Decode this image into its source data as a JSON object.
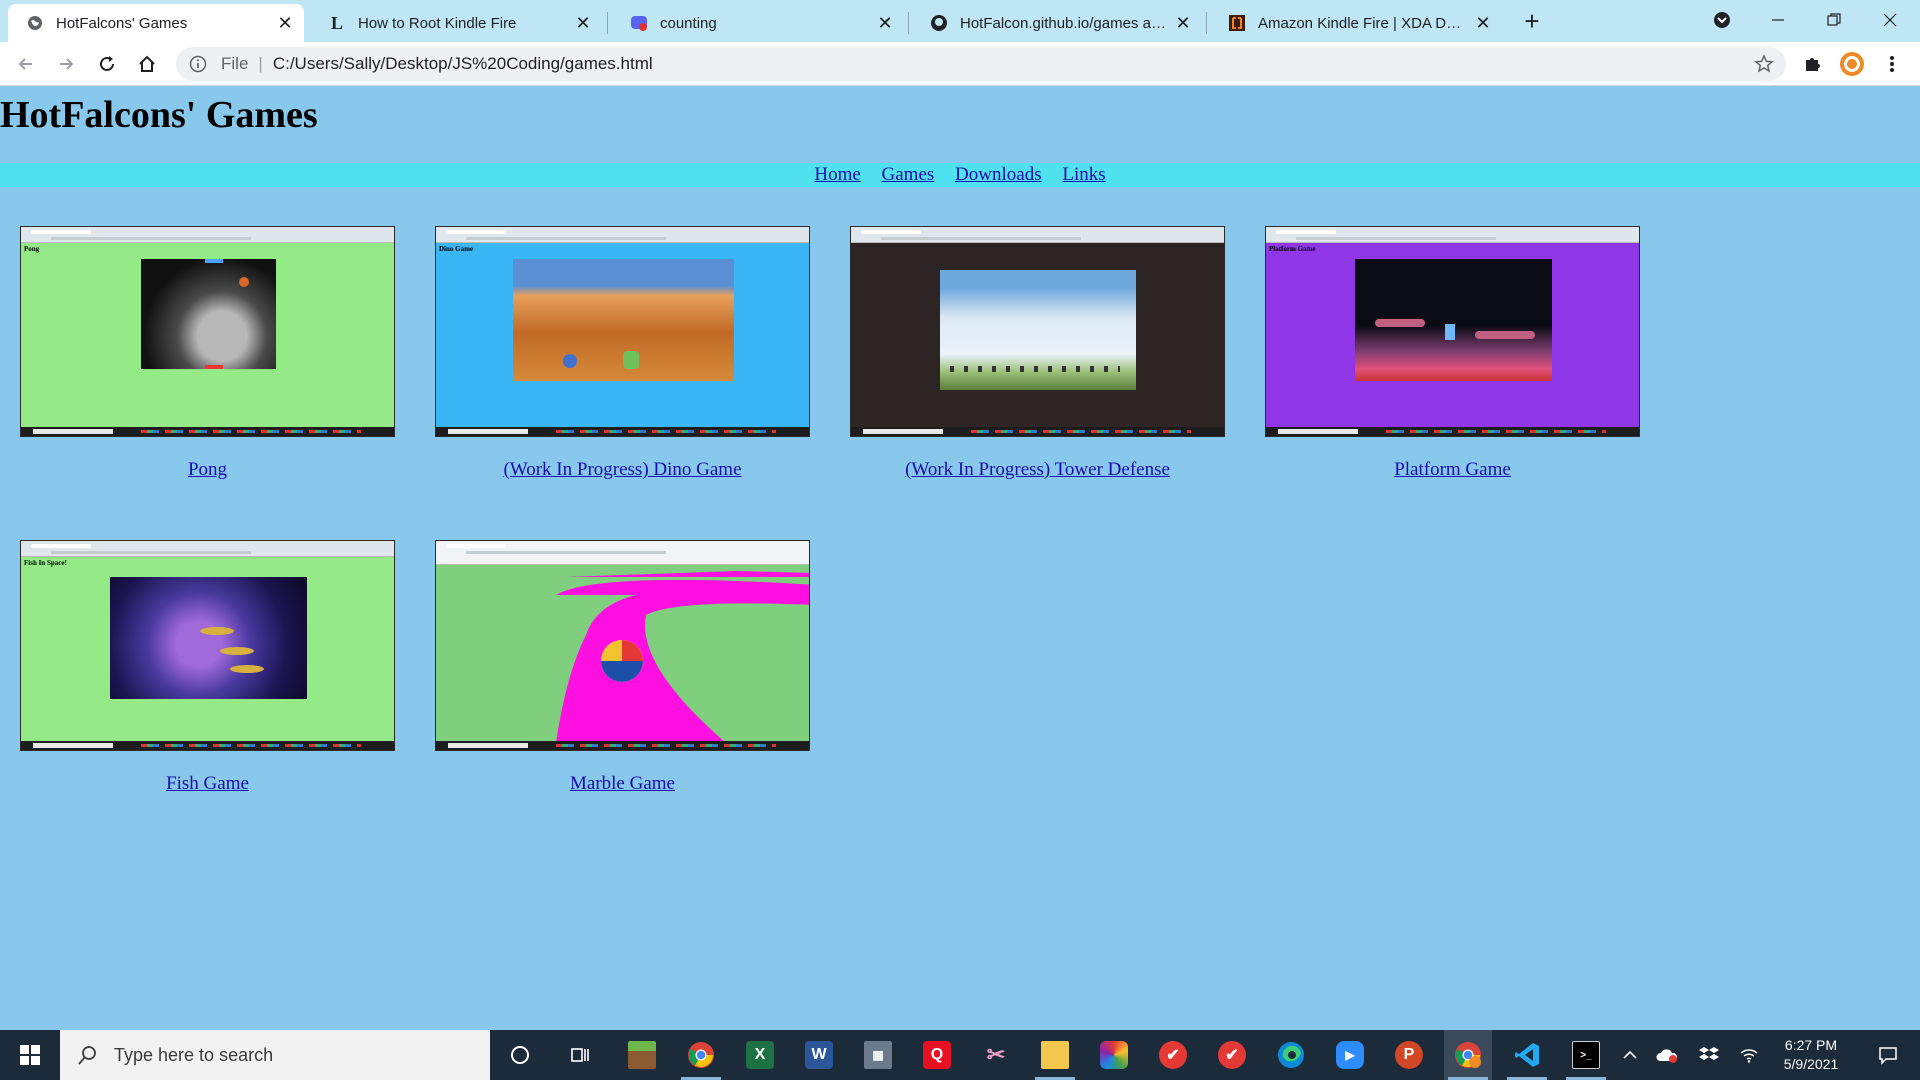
{
  "browser": {
    "tabs": [
      {
        "title": "HotFalcons' Games",
        "active": true
      },
      {
        "title": "How to Root Kindle Fire",
        "active": false
      },
      {
        "title": "counting",
        "active": false
      },
      {
        "title": "HotFalcon.github.io/games at ma",
        "active": false
      },
      {
        "title": "Amazon Kindle Fire | XDA Develo",
        "active": false
      }
    ],
    "new_tab_symbol": "+",
    "url_scheme": "File",
    "url": "C:/Users/Sally/Desktop/JS%20Coding/games.html"
  },
  "page": {
    "title": "HotFalcons' Games",
    "nav": [
      "Home",
      "Games",
      "Downloads",
      "Links"
    ],
    "games": [
      {
        "caption": "Pong",
        "thumb_label": "Pong",
        "bg": "#93ea86"
      },
      {
        "caption": "(Work In Progress) Dino Game",
        "thumb_label": "Dino Game",
        "bg": "#3bb6f5"
      },
      {
        "caption": "(Work In Progress) Tower Defense",
        "thumb_label": "",
        "bg": "#2d2424"
      },
      {
        "caption": "Platform Game",
        "thumb_label": "Platform Game",
        "bg": "#8f36e6"
      },
      {
        "caption": "Fish Game",
        "thumb_label": "Fish In Space!",
        "bg": "#93ea86"
      },
      {
        "caption": "Marble Game",
        "thumb_label": "",
        "bg": "#7fcf7e"
      }
    ]
  },
  "taskbar": {
    "search_placeholder": "Type here to search",
    "apps": [
      "cortana",
      "task-view",
      "minecraft",
      "chrome",
      "excel",
      "word",
      "calculator",
      "quicktime",
      "snipping-tool",
      "file-explorer",
      "photos",
      "todo",
      "todo-2",
      "edge",
      "zoom",
      "powerpoint",
      "chrome-profile",
      "vscode",
      "terminal"
    ],
    "time": "6:27 PM",
    "date": "5/9/2021"
  }
}
